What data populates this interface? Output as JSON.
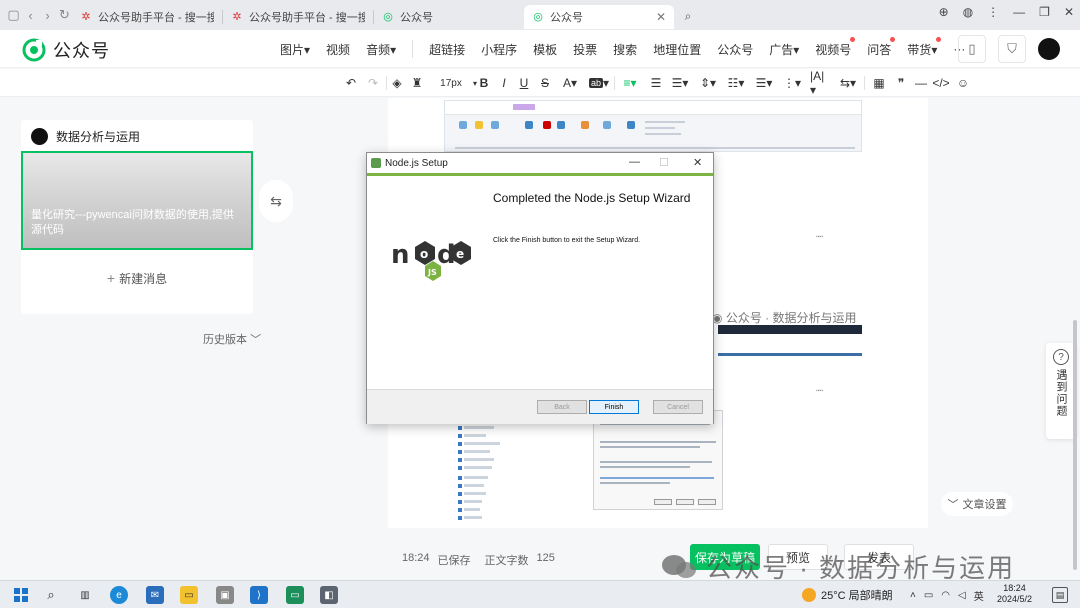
{
  "browser": {
    "tabs": [
      {
        "title": "公众号助手平台 - 搜一搜",
        "icon": "sogou-icon"
      },
      {
        "title": "公众号助手平台 - 搜一搜",
        "icon": "sogou-icon"
      },
      {
        "title": "公众号",
        "icon": "wechat-mp-icon"
      },
      {
        "title": "公众号",
        "icon": "wechat-mp-icon",
        "active": true
      }
    ]
  },
  "header": {
    "logo_text": "公众号",
    "menu_left": [
      "图片",
      "视频",
      "音频"
    ],
    "menu_right": [
      "超链接",
      "小程序",
      "模板",
      "投票",
      "搜索",
      "地理位置",
      "公众号",
      "广告",
      "视频号",
      "问答",
      "带货",
      "···"
    ]
  },
  "toolbar": {
    "font_size": "17px"
  },
  "left_panel": {
    "account_name": "数据分析与运用",
    "article_title": "量化研究---pywencai问财数据的使用,提供源代码",
    "new_message": "新建消息",
    "new_message_plus": "+",
    "history": "历史版本",
    "history_chevron": "﹀"
  },
  "canvas": {
    "watermark_inline": "公众号 · 数据分析与运用"
  },
  "dialog": {
    "title": "Node.js Setup",
    "heading": "Completed the Node.js Setup Wizard",
    "body": "Click the Finish button to exit the Setup Wizard.",
    "buttons": {
      "back": "Back",
      "finish": "Finish",
      "cancel": "Cancel"
    }
  },
  "status": {
    "saved_time": "18:24",
    "saved_label": "已保存",
    "word_count_label": "正文字数",
    "word_count": "125",
    "save_draft": "保存为草稿",
    "preview": "预览",
    "publish": "发表"
  },
  "right": {
    "help": "遇到问题",
    "doc_settings": "文章设置"
  },
  "watermark": {
    "text": "公众号 · 数据分析与运用"
  },
  "taskbar": {
    "weather": "25°C 局部晴朗",
    "ime": "英",
    "time": "18:24",
    "date": "2024/5/2"
  },
  "colors": {
    "brand_green": "#07c160",
    "node_green": "#7cb342"
  }
}
